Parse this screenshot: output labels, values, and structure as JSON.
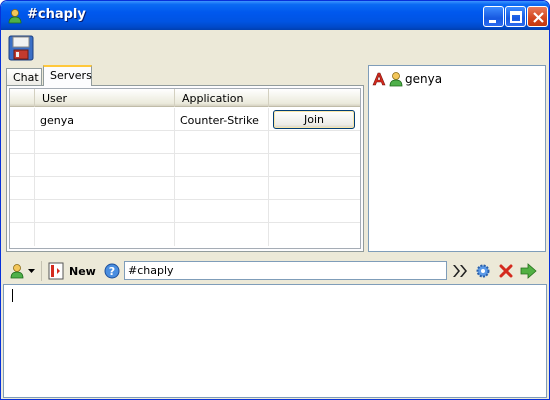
{
  "window": {
    "title": "#chaply"
  },
  "tabs": [
    {
      "label": "Chat",
      "active": false
    },
    {
      "label": "Servers",
      "active": true
    }
  ],
  "servers_table": {
    "columns": [
      "User",
      "Application",
      ""
    ],
    "rows": [
      {
        "user": "genya",
        "application": "Counter-Strike",
        "action": "Join"
      }
    ]
  },
  "users_panel": {
    "users": [
      {
        "name": "genya",
        "icons": [
          "font-a-icon",
          "user-icon"
        ]
      }
    ]
  },
  "bottom_toolbar": {
    "new_label": "New",
    "channel_value": "#chaply"
  },
  "colors": {
    "titlebar": "#0054e3",
    "tab_highlight": "#ffc83c",
    "window_bg": "#ece9d8"
  }
}
